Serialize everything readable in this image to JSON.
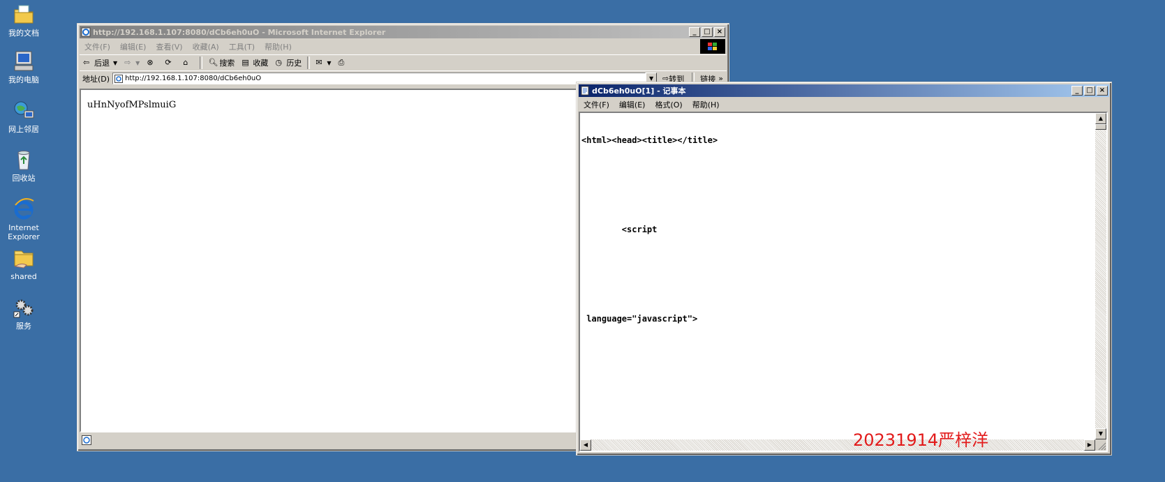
{
  "desktop": {
    "icons": [
      {
        "name": "my-documents-icon",
        "label": "我的文档"
      },
      {
        "name": "my-computer-icon",
        "label": "我的电脑"
      },
      {
        "name": "network-places-icon",
        "label": "网上邻居"
      },
      {
        "name": "recycle-bin-icon",
        "label": "回收站"
      },
      {
        "name": "internet-explorer-icon",
        "label": "Internet\nExplorer"
      },
      {
        "name": "shared-folder-icon",
        "label": "shared"
      },
      {
        "name": "services-icon",
        "label": "服务"
      }
    ]
  },
  "ie": {
    "title": "http://192.168.1.107:8080/dCb6eh0uO - Microsoft Internet Explorer",
    "menu": [
      "文件(F)",
      "编辑(E)",
      "查看(V)",
      "收藏(A)",
      "工具(T)",
      "帮助(H)"
    ],
    "toolbar": {
      "back": "后退",
      "search": "搜索",
      "favorites": "收藏",
      "history": "历史"
    },
    "address_label": "地址(D)",
    "address_value": "http://192.168.1.107:8080/dCb6eh0uO",
    "go_label": "转到",
    "links_label": "链接",
    "page_text": "uHnNyofMPslmuiG"
  },
  "notepad": {
    "title": "dCb6eh0uO[1] - 记事本",
    "menu": [
      "文件(F)",
      "编辑(E)",
      "格式(O)",
      "帮助(H)"
    ],
    "lines": [
      "<html><head><title></title>",
      "        <script",
      " language=\"javascript\">"
    ]
  },
  "watermark": "20231914严梓洋",
  "colors": {
    "desktop": "#3a6ea5",
    "window_face": "#d4d0c8",
    "active_title": "#0a246a",
    "watermark": "#e21b1b"
  }
}
